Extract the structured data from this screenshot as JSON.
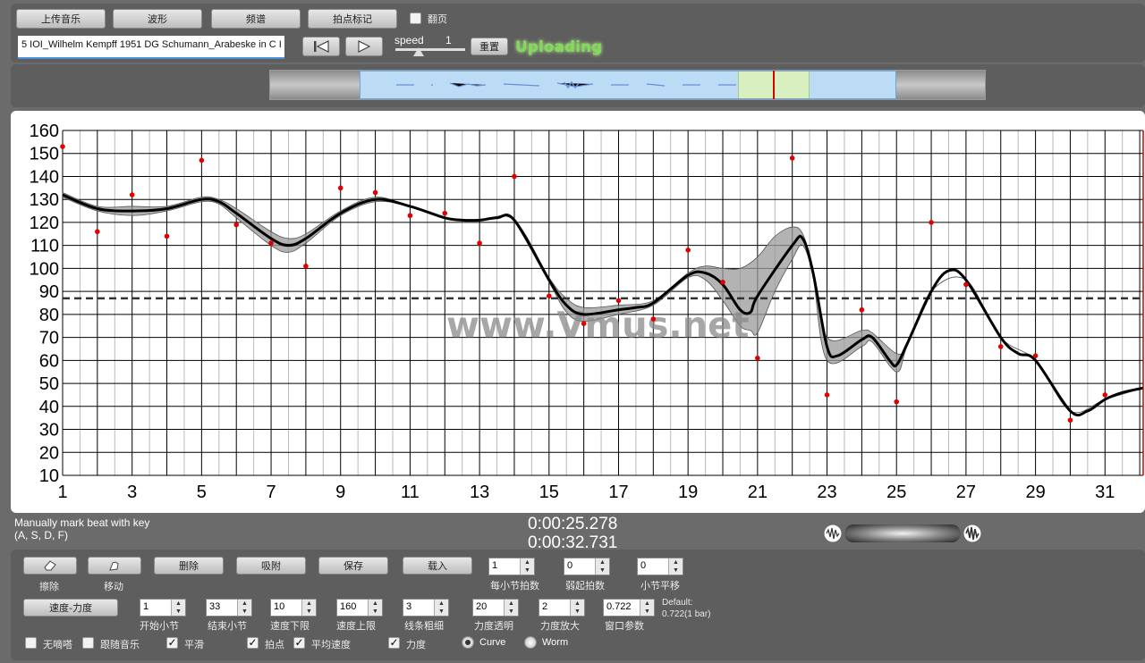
{
  "toolbar": {
    "upload_music": "上传音乐",
    "waveform": "波形",
    "spectrum": "频谱",
    "beat_mark": "拍点标记",
    "page_turn": "翻页",
    "file_name": "5 IOI_Wilhelm Kempff 1951 DG Schumann_Arabeske in C I",
    "speed_label": "speed",
    "speed_value": "1",
    "reset_label": "重置",
    "status": "Uploading"
  },
  "colors": {
    "status": "#7fdc5a",
    "points": "#e00000",
    "curve": "#000000",
    "band": "#9a9a9a",
    "cursor": "#d40000"
  },
  "chart_data": {
    "type": "line",
    "title": "",
    "xlabel": "",
    "ylabel": "",
    "xlim": [
      1,
      32.1
    ],
    "ylim": [
      10,
      160
    ],
    "x_ticks": [
      "1",
      "3",
      "5",
      "7",
      "9",
      "11",
      "13",
      "15",
      "17",
      "19",
      "21",
      "23",
      "25",
      "27",
      "29",
      "31"
    ],
    "y_ticks": [
      "160",
      "150",
      "140",
      "130",
      "120",
      "110",
      "100",
      "90",
      "80",
      "70",
      "60",
      "50",
      "40",
      "30",
      "20",
      "10"
    ],
    "average_tempo": 87,
    "cursor_x": 32.1,
    "watermark": "www.Vmus.net",
    "curve": [
      [
        1,
        132
      ],
      [
        2,
        126
      ],
      [
        3,
        125
      ],
      [
        4,
        126
      ],
      [
        5,
        130
      ],
      [
        5.5,
        129
      ],
      [
        6,
        124
      ],
      [
        7,
        113
      ],
      [
        7.5,
        110
      ],
      [
        8,
        113
      ],
      [
        9,
        124
      ],
      [
        10,
        130
      ],
      [
        11,
        127
      ],
      [
        12,
        122
      ],
      [
        12.5,
        121
      ],
      [
        13,
        121
      ],
      [
        13.5,
        122
      ],
      [
        14,
        121
      ],
      [
        15,
        95
      ],
      [
        15.5,
        84
      ],
      [
        16,
        80
      ],
      [
        17,
        82
      ],
      [
        17.5,
        83
      ],
      [
        18,
        85
      ],
      [
        19,
        97
      ],
      [
        19.5,
        98
      ],
      [
        20,
        93
      ],
      [
        20.5,
        82
      ],
      [
        20.8,
        81
      ],
      [
        21,
        88
      ],
      [
        22,
        110
      ],
      [
        22.3,
        113
      ],
      [
        22.6,
        98
      ],
      [
        23,
        66
      ],
      [
        23.3,
        62
      ],
      [
        24,
        69
      ],
      [
        24.3,
        70
      ],
      [
        24.8,
        60
      ],
      [
        25,
        58
      ],
      [
        25.3,
        67
      ],
      [
        26,
        90
      ],
      [
        26.5,
        99
      ],
      [
        27,
        95
      ],
      [
        28,
        70
      ],
      [
        28.5,
        63
      ],
      [
        29,
        60
      ],
      [
        30,
        38
      ],
      [
        30.5,
        38
      ],
      [
        31,
        43
      ],
      [
        31.5,
        46
      ],
      [
        32.1,
        48
      ]
    ],
    "band_upper": [
      [
        1,
        133
      ],
      [
        2,
        127
      ],
      [
        3,
        127
      ],
      [
        4,
        127
      ],
      [
        5,
        131
      ],
      [
        5.5,
        130
      ],
      [
        6,
        126
      ],
      [
        7,
        116
      ],
      [
        7.5,
        113
      ],
      [
        8,
        115
      ],
      [
        9,
        125
      ],
      [
        10,
        131
      ],
      [
        11,
        127
      ],
      [
        12,
        122
      ],
      [
        13,
        121
      ],
      [
        14,
        121
      ],
      [
        15,
        96
      ],
      [
        15.5,
        87
      ],
      [
        16,
        83
      ],
      [
        17,
        84
      ],
      [
        18,
        86
      ],
      [
        19,
        98
      ],
      [
        19.5,
        101
      ],
      [
        20,
        100
      ],
      [
        20.5,
        100
      ],
      [
        21,
        105
      ],
      [
        21.5,
        114
      ],
      [
        22,
        118
      ],
      [
        22.3,
        115
      ],
      [
        22.6,
        100
      ],
      [
        23,
        70
      ],
      [
        24,
        73
      ],
      [
        24.3,
        72
      ],
      [
        25,
        63
      ],
      [
        25.3,
        67
      ],
      [
        26,
        90
      ],
      [
        27,
        95
      ],
      [
        28,
        70
      ],
      [
        29,
        60
      ],
      [
        30,
        38
      ],
      [
        31,
        43
      ],
      [
        32.1,
        48
      ]
    ],
    "band_lower": [
      [
        1,
        131
      ],
      [
        2,
        125
      ],
      [
        3,
        123
      ],
      [
        4,
        125
      ],
      [
        5,
        129
      ],
      [
        5.5,
        128
      ],
      [
        6,
        122
      ],
      [
        7,
        110
      ],
      [
        7.5,
        107
      ],
      [
        8,
        111
      ],
      [
        9,
        123
      ],
      [
        10,
        129
      ],
      [
        11,
        127
      ],
      [
        12,
        122
      ],
      [
        13,
        121
      ],
      [
        14,
        121
      ],
      [
        15,
        94
      ],
      [
        15.5,
        81
      ],
      [
        16,
        77
      ],
      [
        17,
        80
      ],
      [
        18,
        84
      ],
      [
        19,
        96
      ],
      [
        19.5,
        95
      ],
      [
        20,
        86
      ],
      [
        20.5,
        75
      ],
      [
        20.8,
        73
      ],
      [
        21,
        72
      ],
      [
        21.5,
        90
      ],
      [
        22,
        104
      ],
      [
        22.3,
        110
      ],
      [
        22.6,
        96
      ],
      [
        23,
        60
      ],
      [
        24,
        66
      ],
      [
        24.3,
        68
      ],
      [
        25,
        55
      ],
      [
        25.3,
        66
      ],
      [
        26,
        90
      ],
      [
        27,
        95
      ],
      [
        28,
        70
      ],
      [
        29,
        60
      ],
      [
        30,
        38
      ],
      [
        31,
        43
      ],
      [
        32.1,
        48
      ]
    ],
    "points": [
      [
        1,
        153
      ],
      [
        2,
        116
      ],
      [
        3,
        132
      ],
      [
        4,
        114
      ],
      [
        5,
        147
      ],
      [
        6,
        119
      ],
      [
        7,
        111
      ],
      [
        8,
        101
      ],
      [
        9,
        135
      ],
      [
        10,
        133
      ],
      [
        11,
        123
      ],
      [
        12,
        124
      ],
      [
        13,
        111
      ],
      [
        14,
        140
      ],
      [
        15,
        88
      ],
      [
        16,
        76
      ],
      [
        17,
        86
      ],
      [
        18,
        78
      ],
      [
        19,
        108
      ],
      [
        20,
        94
      ],
      [
        21,
        61
      ],
      [
        22,
        148
      ],
      [
        23,
        45
      ],
      [
        24,
        82
      ],
      [
        25,
        42
      ],
      [
        26,
        120
      ],
      [
        27,
        93
      ],
      [
        28,
        66
      ],
      [
        29,
        62
      ],
      [
        30,
        34
      ],
      [
        31,
        45
      ]
    ]
  },
  "mid": {
    "hint_line1": "Manually mark beat with key",
    "hint_line2": "(A, S, D, F)",
    "time_current": "0:00:25.278",
    "time_total": "0:00:32.731"
  },
  "bottom": {
    "erase_label": "擦除",
    "move_label": "移动",
    "delete": "删除",
    "snap": "吸附",
    "save": "保存",
    "load": "载入",
    "beats_per_bar_value": "1",
    "beats_per_bar_label": "每小节拍数",
    "weak_beats_value": "0",
    "weak_beats_label": "弱起拍数",
    "bar_shift_value": "0",
    "bar_shift_label": "小节平移",
    "tempo_dynamics": "速度-力度",
    "start_bar_value": "1",
    "start_bar_label": "开始小节",
    "end_bar_value": "33",
    "end_bar_label": "结束小节",
    "tempo_low_value": "10",
    "tempo_low_label": "速度下限",
    "tempo_high_value": "160",
    "tempo_high_label": "速度上限",
    "line_width_value": "3",
    "line_width_label": "线条粗细",
    "dyn_opacity_value": "20",
    "dyn_opacity_label": "力度透明",
    "dyn_zoom_value": "2",
    "dyn_zoom_label": "力度放大",
    "window_value": "0.722",
    "window_label": "窗口参数",
    "default_line1": "Default:",
    "default_line2": "0.722(1 bar)",
    "metronome": "无嘀嗒",
    "follow_music": "跟随音乐",
    "smooth": "平滑",
    "beat_points": "拍点",
    "avg_tempo": "平均速度",
    "dynamics": "力度",
    "curve": "Curve",
    "worm": "Worm"
  }
}
